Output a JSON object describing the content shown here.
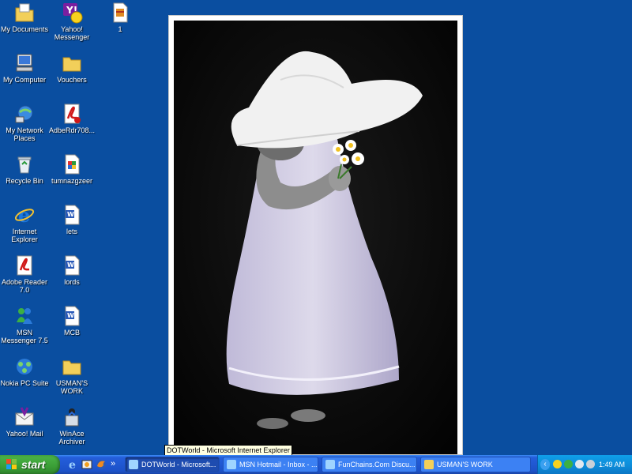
{
  "desktop": {
    "icons": [
      {
        "label": "My Documents"
      },
      {
        "label": "Yahoo! Messenger"
      },
      {
        "label": "1"
      },
      {
        "label": "My Computer"
      },
      {
        "label": "Vouchers"
      },
      {
        "label": "My Network Places"
      },
      {
        "label": "AdbeRdr708..."
      },
      {
        "label": "Recycle Bin"
      },
      {
        "label": "tumnazgzeer"
      },
      {
        "label": "Internet Explorer"
      },
      {
        "label": "lets"
      },
      {
        "label": "Adobe Reader 7.0"
      },
      {
        "label": "lords"
      },
      {
        "label": "MSN Messenger 7.5"
      },
      {
        "label": "MCB"
      },
      {
        "label": "Nokia PC Suite"
      },
      {
        "label": "USMAN'S WORK"
      },
      {
        "label": "Yahoo! Mail"
      },
      {
        "label": "WinAce Archiver"
      }
    ]
  },
  "tooltip": "DOTWorld - Microsoft Internet Explorer",
  "taskbar": {
    "start_label": "start",
    "quick_launch": [
      "internet-explorer-icon",
      "outlook-icon",
      "firefox-icon"
    ],
    "expand_glyph": "»",
    "buttons": [
      {
        "label": "DOTWorld - Microsoft..."
      },
      {
        "label": "MSN Hotmail - Inbox - ..."
      },
      {
        "label": "FunChains.Com Discu..."
      },
      {
        "label": "USMAN'S WORK"
      }
    ],
    "tray_collapse_glyph": "‹",
    "clock": "1:49 AM"
  },
  "colors": {
    "desktop_bg": "#0a4ea0",
    "taskbar": "#245edb",
    "start_green": "#3a9e36"
  }
}
